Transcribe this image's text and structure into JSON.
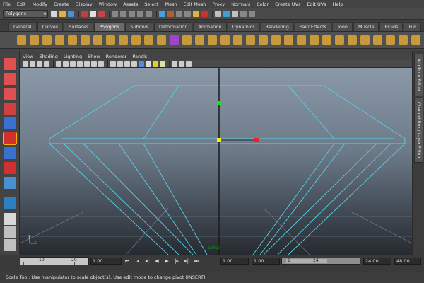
{
  "menubar": {
    "items": [
      "File",
      "Edit",
      "Modify",
      "Create",
      "Display",
      "Window",
      "Assets",
      "Select",
      "Mesh",
      "Edit Mesh",
      "Proxy",
      "Normals",
      "Color",
      "Create UVs",
      "Edit UVs",
      "Help"
    ]
  },
  "status_line": {
    "mode_value": "Polygons",
    "dropdown_icon": "chevron-down-icon",
    "icons": [
      "new-scene-icon",
      "open-scene-icon",
      "save-scene-icon",
      "select-hierarchy-icon",
      "select-object-icon",
      "select-component-icon",
      "snap-grid-icon",
      "snap-curve-icon",
      "snap-point-icon",
      "snap-plane-icon",
      "history-icon",
      "render-icon",
      "ipr-render-icon",
      "render-settings-icon",
      "hypershade-icon",
      "lock-icon",
      "camera-icon",
      "input-output-icon",
      "construction-history-icon",
      "show-hide-icon",
      "renderview-icon",
      "sidebar-toggle-icon"
    ]
  },
  "shelf": {
    "tabs": [
      "General",
      "Curves",
      "Surfaces",
      "Polygons",
      "Subdivs",
      "Deformation",
      "Animation",
      "Dynamics",
      "Rendering",
      "PaintEffects",
      "Toon",
      "Muscle",
      "Fluids",
      "Fur"
    ],
    "active_tab": "Polygons",
    "icon_color": "#c89a3c",
    "accent_icon_color": "#a044c8"
  },
  "toolbox": {
    "active_tool": "scale-tool",
    "tools": [
      "select-tool-icon",
      "lasso-tool-icon",
      "paint-select-tool-icon",
      "move-tool-icon",
      "rotate-tool-icon",
      "scale-tool-icon",
      "universal-manipulator-icon",
      "soft-mod-icon",
      "show-manipulator-icon",
      "last-tool-icon",
      "single-perspective-layout-icon",
      "four-view-layout-icon",
      "outliner-layout-icon"
    ]
  },
  "panel": {
    "menu": [
      "View",
      "Shading",
      "Lighting",
      "Show",
      "Renderer",
      "Panels"
    ]
  },
  "viewport": {
    "camera_label": "persp",
    "axis_y": "y",
    "axis_x": "x",
    "wire_color": "#5ad0e8",
    "manip_y_color": "#22dd22",
    "manip_x_color": "#ee2222",
    "manip_center_color": "#ffee00"
  },
  "side_dock": {
    "tabs": [
      "Attribute Editor",
      "Channel Box / Layer Editor"
    ]
  },
  "timeline": {
    "ticks": [
      "10",
      "20"
    ],
    "current_time": "1.00",
    "range_start": "1.00",
    "range_field_small": "1.00",
    "range_inner_start": "1",
    "range_inner_end": "24",
    "range_end": "24.00",
    "playback_end": "48.00"
  },
  "help_line": {
    "text": "Scale Tool: Use manipulator to scale object(s). Use edit mode to change pivot (INSERT)."
  }
}
